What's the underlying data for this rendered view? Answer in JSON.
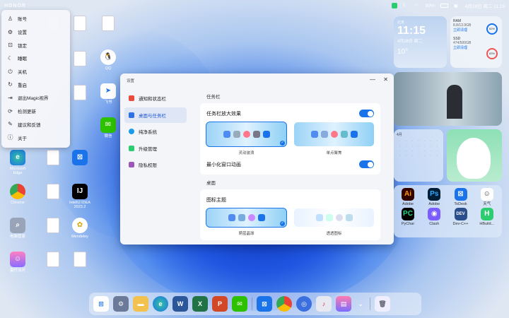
{
  "brand": "HONOR",
  "tray": {
    "battery": "99%",
    "datetime": "4月28日 周二 11:15"
  },
  "start_menu": {
    "items": [
      {
        "label": "账号",
        "icon": "person-icon"
      },
      {
        "label": "设置",
        "icon": "gear-icon"
      },
      {
        "label": "锁定",
        "icon": "lock-icon"
      },
      {
        "label": "睡眠",
        "icon": "moon-icon"
      },
      {
        "label": "关机",
        "icon": "power-icon"
      },
      {
        "label": "重启",
        "icon": "restart-icon"
      },
      {
        "label": "退出Magic视界",
        "icon": "exit-icon"
      },
      {
        "label": "检测更新",
        "icon": "update-icon"
      },
      {
        "label": "建议和反馈",
        "icon": "feedback-icon"
      },
      {
        "label": "关于",
        "icon": "info-icon"
      }
    ]
  },
  "desktop_icons": [
    {
      "label": "Microsoft Edge"
    },
    {
      "label": "Chrome"
    },
    {
      "label": "电脑管家"
    },
    {
      "label": "蛋仔派对"
    },
    {
      "label": "QQ"
    },
    {
      "label": "飞书"
    },
    {
      "label": "微信"
    },
    {
      "label": "IntelliJ IDEA 2023.2"
    },
    {
      "label": "Mendeley"
    },
    {
      "label": "Typora"
    }
  ],
  "settings": {
    "window_title": "设置",
    "nav": [
      {
        "label": "通知和状态栏"
      },
      {
        "label": "桌面与任务栏"
      },
      {
        "label": "纯净系统"
      },
      {
        "label": "升级管理"
      },
      {
        "label": "隐私权限"
      }
    ],
    "taskbar_section": "任务栏",
    "taskbar_magnify": "任务栏放大效果",
    "style_options": [
      {
        "label": "灵动波浪"
      },
      {
        "label": "单点聚焦"
      }
    ],
    "minimize_anim": "最小化窗口动画",
    "desktop_section": "桌面",
    "icon_theme": "图标主题",
    "theme_options": [
      {
        "label": "萌蓝晶球"
      },
      {
        "label": "透透图标"
      }
    ]
  },
  "widgets": {
    "weather": {
      "city": "北京",
      "time": "11:15",
      "date": "4月28日 周二",
      "temp": "10°"
    },
    "storage": {
      "ram_label": "RAM",
      "ram_value": "8.8/13.9GB",
      "ram_pct": "62%",
      "ram_action": "立即清理",
      "ssd_label": "SSD",
      "ssd_value": "474/500GB",
      "ssd_pct": "83%",
      "ssd_action": "立即清理"
    },
    "calendar": {
      "month": "4月"
    },
    "apps": [
      {
        "label": "Adobe"
      },
      {
        "label": "Adobe"
      },
      {
        "label": "ToDesk"
      },
      {
        "label": "天气"
      },
      {
        "label": "PyChar"
      },
      {
        "label": "Clash"
      },
      {
        "label": "Dev-C++"
      },
      {
        "label": "HBuild..."
      }
    ]
  },
  "colors": {
    "accent": "#1a73e8"
  }
}
